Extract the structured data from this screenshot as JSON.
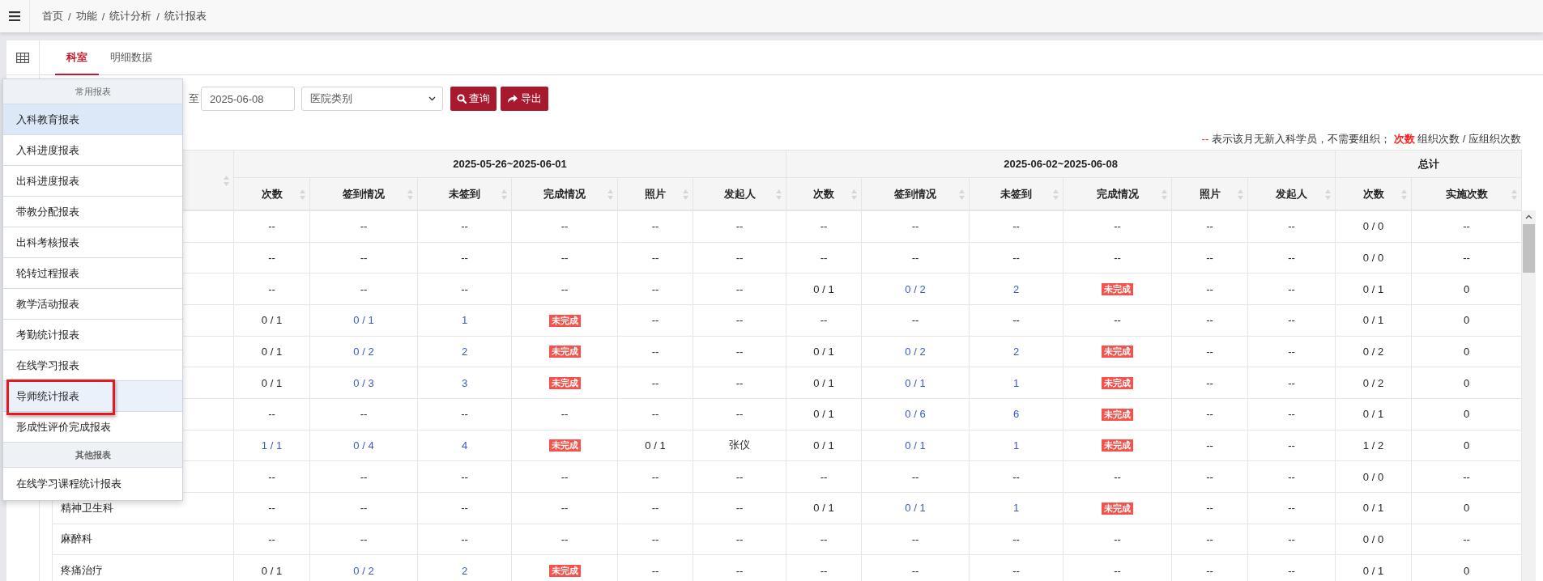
{
  "header": {
    "breadcrumb": [
      "首页",
      "功能",
      "统计分析",
      "统计报表"
    ],
    "separator": "/"
  },
  "tabs": [
    {
      "label": "科室",
      "selected": true
    },
    {
      "label": "明细数据",
      "selected": false
    }
  ],
  "filter": {
    "separator": "至",
    "end_date": "2025-06-08",
    "category": "医院类别",
    "buttons": [
      {
        "label": "查询",
        "kind": "search"
      },
      {
        "label": "导出",
        "kind": "export"
      }
    ]
  },
  "legend": {
    "dash_mark": "--",
    "dash_text": "表示该月无新入科学员，不需要组织；",
    "count_mark": "次数",
    "count_text": "组织次数 / 应组织次数"
  },
  "table": {
    "groups": [
      {
        "label": "2025-05-26~2025-06-01",
        "columns": [
          "次数",
          "签到情况",
          "未签到",
          "完成情况",
          "照片",
          "发起人"
        ]
      },
      {
        "label": "2025-06-02~2025-06-08",
        "columns": [
          "次数",
          "签到情况",
          "未签到",
          "完成情况",
          "照片",
          "发起人"
        ]
      },
      {
        "label": "总计",
        "columns": [
          "次数",
          "实施次数"
        ]
      }
    ],
    "rows": [
      {
        "cells": [
          "--",
          "--",
          "--",
          "--",
          "--",
          "--",
          "--",
          "--",
          "--",
          "--",
          "--",
          "--",
          "0 / 0",
          "--"
        ]
      },
      {
        "cells": [
          "--",
          "--",
          "--",
          "--",
          "--",
          "--",
          "--",
          "--",
          "--",
          "--",
          "--",
          "--",
          "0 / 0",
          "--"
        ]
      },
      {
        "cells": [
          "--",
          "--",
          "--",
          "--",
          "--",
          "--",
          "0 / 1",
          {
            "text": "0 / 2",
            "kind": "link"
          },
          {
            "text": "2",
            "kind": "link"
          },
          {
            "text": "未完成",
            "kind": "badge"
          },
          "--",
          "--",
          "0 / 1",
          "0"
        ]
      },
      {
        "cells": [
          "0 / 1",
          {
            "text": "0 / 1",
            "kind": "link"
          },
          {
            "text": "1",
            "kind": "link"
          },
          {
            "text": "未完成",
            "kind": "badge"
          },
          "--",
          "--",
          "--",
          "--",
          "--",
          "--",
          "--",
          "--",
          "0 / 1",
          "0"
        ]
      },
      {
        "cells": [
          "0 / 1",
          {
            "text": "0 / 2",
            "kind": "link"
          },
          {
            "text": "2",
            "kind": "link"
          },
          {
            "text": "未完成",
            "kind": "badge"
          },
          "--",
          "--",
          "0 / 1",
          {
            "text": "0 / 2",
            "kind": "link"
          },
          {
            "text": "2",
            "kind": "link"
          },
          {
            "text": "未完成",
            "kind": "badge"
          },
          "--",
          "--",
          "0 / 2",
          "0"
        ]
      },
      {
        "cells": [
          "0 / 1",
          {
            "text": "0 / 3",
            "kind": "link"
          },
          {
            "text": "3",
            "kind": "link"
          },
          {
            "text": "未完成",
            "kind": "badge"
          },
          "--",
          "--",
          "0 / 1",
          {
            "text": "0 / 1",
            "kind": "link"
          },
          {
            "text": "1",
            "kind": "link"
          },
          {
            "text": "未完成",
            "kind": "badge"
          },
          "--",
          "--",
          "0 / 2",
          "0"
        ]
      },
      {
        "cells": [
          "--",
          "--",
          "--",
          "--",
          "--",
          "--",
          "0 / 1",
          {
            "text": "0 / 6",
            "kind": "link"
          },
          {
            "text": "6",
            "kind": "link"
          },
          {
            "text": "未完成",
            "kind": "badge"
          },
          "--",
          "--",
          "0 / 1",
          "0"
        ]
      },
      {
        "cells": [
          {
            "text": "1 / 1",
            "kind": "link"
          },
          {
            "text": "0 / 4",
            "kind": "link"
          },
          {
            "text": "4",
            "kind": "link"
          },
          {
            "text": "未完成",
            "kind": "badge"
          },
          "0 / 1",
          "张仪",
          "0 / 1",
          {
            "text": "0 / 1",
            "kind": "link"
          },
          {
            "text": "1",
            "kind": "link"
          },
          {
            "text": "未完成",
            "kind": "badge"
          },
          "--",
          "--",
          "1 / 2",
          "0"
        ]
      },
      {
        "cells": [
          "--",
          "--",
          "--",
          "--",
          "--",
          "--",
          "--",
          "--",
          "--",
          "--",
          "--",
          "--",
          "0 / 0",
          "--"
        ]
      },
      {
        "name": "精神卫生科",
        "cells": [
          "--",
          "--",
          "--",
          "--",
          "--",
          "--",
          "0 / 1",
          {
            "text": "0 / 1",
            "kind": "link"
          },
          {
            "text": "1",
            "kind": "link"
          },
          {
            "text": "未完成",
            "kind": "badge"
          },
          "--",
          "--",
          "0 / 1",
          "0"
        ]
      },
      {
        "name": "麻醉科",
        "cells": [
          "--",
          "--",
          "--",
          "--",
          "--",
          "--",
          "--",
          "--",
          "--",
          "--",
          "--",
          "--",
          "0 / 0",
          "--"
        ]
      },
      {
        "name": "疼痛治疗",
        "cells": [
          "0 / 1",
          {
            "text": "0 / 2",
            "kind": "link"
          },
          {
            "text": "2",
            "kind": "link"
          },
          {
            "text": "未完成",
            "kind": "badge"
          },
          "--",
          "--",
          "--",
          "--",
          "--",
          "--",
          "--",
          "--",
          "0 / 1",
          "0"
        ]
      }
    ]
  },
  "report_menu": {
    "groups": [
      {
        "title": "常用报表",
        "items": [
          {
            "label": "入科教育报表",
            "selected": true,
            "hovered": false,
            "annotated": false
          },
          {
            "label": "入科进度报表",
            "selected": false,
            "hovered": false,
            "annotated": false
          },
          {
            "label": "出科进度报表",
            "selected": false,
            "hovered": false,
            "annotated": false
          },
          {
            "label": "带教分配报表",
            "selected": false,
            "hovered": false,
            "annotated": false
          },
          {
            "label": "出科考核报表",
            "selected": false,
            "hovered": false,
            "annotated": false
          },
          {
            "label": "轮转过程报表",
            "selected": false,
            "hovered": false,
            "annotated": false
          },
          {
            "label": "教学活动报表",
            "selected": false,
            "hovered": false,
            "annotated": false
          },
          {
            "label": "考勤统计报表",
            "selected": false,
            "hovered": false,
            "annotated": false
          },
          {
            "label": "在线学习报表",
            "selected": false,
            "hovered": false,
            "annotated": false
          },
          {
            "label": "导师统计报表",
            "selected": false,
            "hovered": true,
            "annotated": true
          },
          {
            "label": "形成性评价完成报表",
            "selected": false,
            "hovered": false,
            "annotated": false
          }
        ]
      },
      {
        "title": "其他报表",
        "items": [
          {
            "label": "在线学习课程统计报表",
            "selected": false,
            "hovered": false,
            "annotated": false
          }
        ]
      }
    ]
  }
}
